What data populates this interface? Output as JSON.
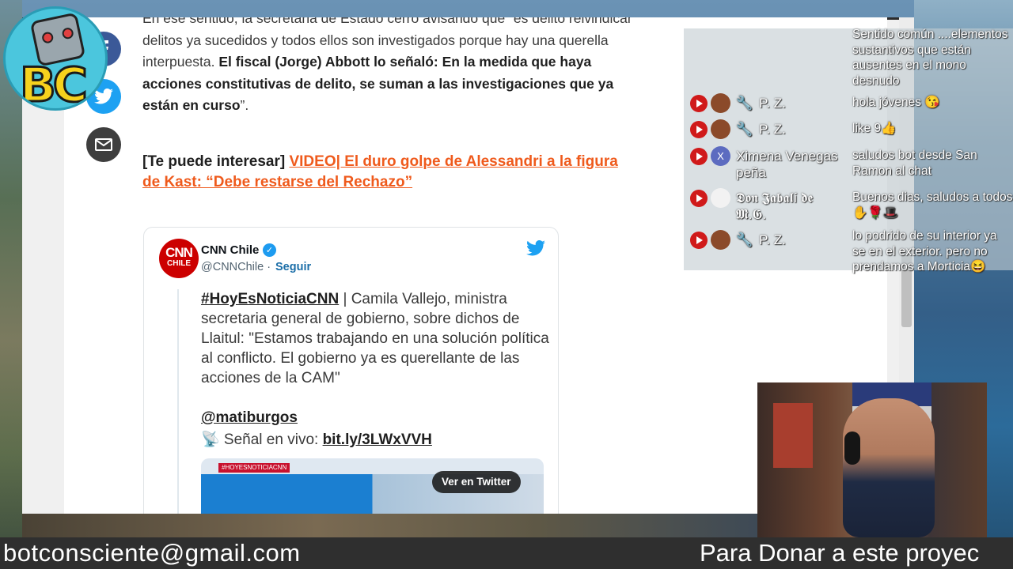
{
  "article": {
    "p1_lines": "En ese sentido, la secretaria de Estado cerró avisando que “es delito reivindicar delitos ya sucedidos y todos ellos son investigados porque hay una querella interpuesta. ",
    "p1_bold": "El fiscal (Jorge) Abbott lo señaló: En la medida que haya acciones constitutivas de delito, se suman a las investigaciones que ya están en curso",
    "p1_end": "”.",
    "interest_prefix": "[Te puede interesar] ",
    "interest_link": "VIDEO| El duro golpe de Alessandri a la figura de Kast: “Debe restarse del Rechazo”"
  },
  "share": {
    "facebook_icon": "facebook-icon",
    "twitter_icon": "twitter-icon",
    "mail_icon": "mail-icon"
  },
  "tweet": {
    "logo_line1": "CNN",
    "logo_line2": "CHILE",
    "author": "CNN Chile",
    "handle": "@CNNChile · ",
    "follow": "Seguir",
    "hashtag": "#HoyEsNoticiaCNN",
    "text": " | Camila Vallejo, ministra secretaria general de gobierno, sobre dichos de Llaitul: \"Estamos trabajando en una solución política al conflicto. El gobierno ya es querellante de las acciones de la CAM\"",
    "mention": "@matiburgos",
    "signal_prefix": "📡 Señal en vivo: ",
    "signal_link": "bit.ly/3LWxVVH",
    "media_tag": "#HOYESNOTICIACNN",
    "view_on_twitter": "Ver en Twitter"
  },
  "logo": {
    "text": "BC"
  },
  "chat": {
    "top_message": "Sentido común ....elementos sustantivos que están ausentes en el mono desnudo",
    "messages": [
      {
        "name": "P. Z.",
        "message": "hola jóvenes 😘",
        "avatar": ""
      },
      {
        "name": "P. Z.",
        "message": "like 9👍",
        "avatar": ""
      },
      {
        "name": "Ximena Venegas peña",
        "message": "saludos bot desde San Ramon al chat",
        "avatar": "X"
      },
      {
        "name": "𝕯𝖔𝖓 𝕵𝖆𝖇𝖆𝖑í 𝖉𝖊 𝕸.𝕲.",
        "message": "Buenos dias, saludos a todos ✋🌹🎩",
        "avatar": ""
      },
      {
        "name": "P. Z.",
        "message": "lo podrido de su interior ya se en el exterior. pero no prendamos a Morticia😆",
        "avatar": ""
      }
    ]
  },
  "footer": {
    "email": "botconsciente@gmail.com",
    "donate": "Para Donar a este proyec"
  },
  "colors": {
    "link_orange": "#ef5a1c",
    "twitter_blue": "#1da1f2",
    "youtube_red": "#d01a1a",
    "cnn_red": "#cc0000"
  }
}
